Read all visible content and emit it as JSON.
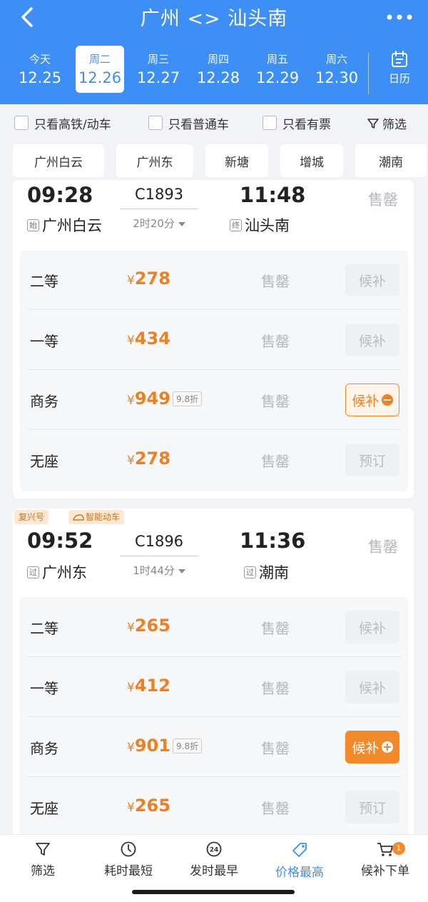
{
  "header": {
    "title": "广州 <> 汕头南",
    "dates": [
      {
        "weekday": "今天",
        "date": "12.25"
      },
      {
        "weekday": "周二",
        "date": "12.26",
        "selected": true
      },
      {
        "weekday": "周三",
        "date": "12.27"
      },
      {
        "weekday": "周四",
        "date": "12.28"
      },
      {
        "weekday": "周五",
        "date": "12.29"
      },
      {
        "weekday": "周六",
        "date": "12.30"
      }
    ],
    "calendar_label": "日历"
  },
  "filters": {
    "high_speed_only": "只看高铁/动车",
    "normal_only": "只看普通车",
    "available_only": "只看有票",
    "filter_label": "筛选"
  },
  "stations": [
    "广州白云",
    "广州东",
    "新塘",
    "增城",
    "潮南"
  ],
  "trains": [
    {
      "tags": [],
      "depart_time": "09:28",
      "train_no": "C1893",
      "arrive_time": "11:48",
      "depart_badge": "始",
      "depart_station": "广州白云",
      "duration": "2时20分",
      "arrive_badge": "终",
      "arrive_station": "汕头南",
      "status": "售罄",
      "seats": [
        {
          "class": "二等",
          "yen": "¥",
          "price": "278",
          "discount": "",
          "status": "售罄",
          "action": "候补",
          "style": "disabled"
        },
        {
          "class": "一等",
          "yen": "¥",
          "price": "434",
          "discount": "",
          "status": "售罄",
          "action": "候补",
          "style": "disabled"
        },
        {
          "class": "商务",
          "yen": "¥",
          "price": "949",
          "discount": "9.8折",
          "status": "售罄",
          "action": "候补",
          "style": "outline"
        },
        {
          "class": "无座",
          "yen": "¥",
          "price": "278",
          "discount": "",
          "status": "售罄",
          "action": "预订",
          "style": "disabled"
        }
      ]
    },
    {
      "tags": [
        "复兴号",
        "智能动车"
      ],
      "depart_time": "09:52",
      "train_no": "C1896",
      "arrive_time": "11:36",
      "depart_badge": "过",
      "depart_station": "广州东",
      "duration": "1时44分",
      "arrive_badge": "过",
      "arrive_station": "潮南",
      "status": "售罄",
      "seats": [
        {
          "class": "二等",
          "yen": "¥",
          "price": "265",
          "discount": "",
          "status": "售罄",
          "action": "候补",
          "style": "disabled"
        },
        {
          "class": "一等",
          "yen": "¥",
          "price": "412",
          "discount": "",
          "status": "售罄",
          "action": "候补",
          "style": "disabled"
        },
        {
          "class": "商务",
          "yen": "¥",
          "price": "901",
          "discount": "9.8折",
          "status": "售罄",
          "action": "候补",
          "style": "solid"
        },
        {
          "class": "无座",
          "yen": "¥",
          "price": "265",
          "discount": "",
          "status": "售罄",
          "action": "预订",
          "style": "disabled"
        }
      ]
    }
  ],
  "bottom_bar": {
    "items": [
      "筛选",
      "耗时最短",
      "发时最早",
      "价格最高",
      "候补下单"
    ],
    "active_index": 3,
    "cart_count": "1",
    "clock_badge": "24"
  },
  "colors": {
    "primary": "#3d8ef5",
    "accent": "#f38a2a",
    "price": "#f0801f"
  },
  "icons": {
    "back": "back-arrow-icon",
    "more": "more-dots-icon",
    "calendar": "calendar-icon",
    "filter": "funnel-icon",
    "clock": "clock-icon",
    "clock24": "clock-24-icon",
    "tag": "price-tag-icon",
    "cart": "cart-icon",
    "dropdown": "triangle-down-icon"
  }
}
